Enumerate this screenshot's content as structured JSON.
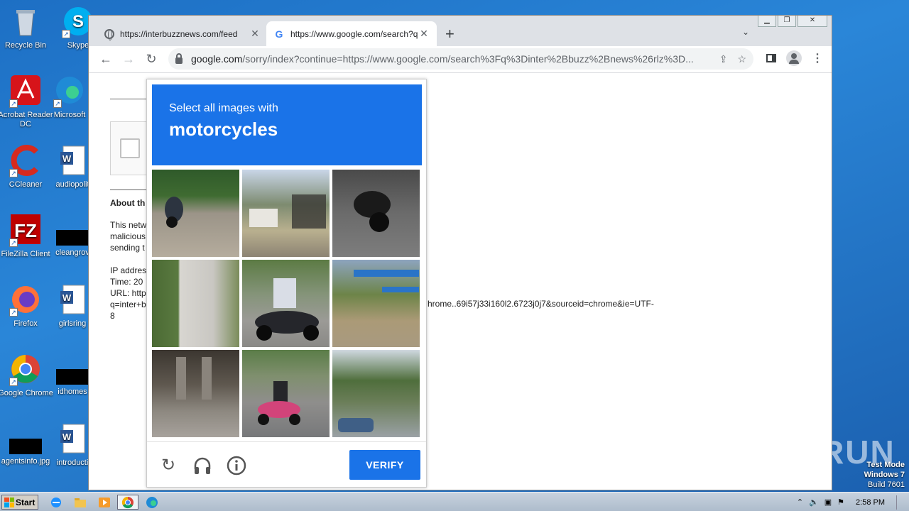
{
  "desktop": {
    "icons": [
      {
        "label": "Recycle Bin"
      },
      {
        "label": "Skype"
      },
      {
        "label": "Acrobat Reader DC"
      },
      {
        "label": "Microsoft"
      },
      {
        "label": "CCleaner"
      },
      {
        "label": "audiopolit"
      },
      {
        "label": "FileZilla Client"
      },
      {
        "label": "cleangrov"
      },
      {
        "label": "Firefox"
      },
      {
        "label": "girlsring"
      },
      {
        "label": "Google Chrome"
      },
      {
        "label": "idhomes"
      },
      {
        "label": "agentsinfo.jpg"
      },
      {
        "label": "introducti"
      }
    ],
    "watermark": "ANY RUN",
    "test_mode": {
      "line1": "Test Mode",
      "line2": "Windows 7",
      "line3": "Build 7601"
    }
  },
  "browser": {
    "tabs": [
      {
        "title": "https://interbuzznews.com/feed",
        "active": false,
        "icon": "globe-icon"
      },
      {
        "title": "https://www.google.com/search?q=",
        "active": true,
        "icon": "google-icon"
      }
    ],
    "address": {
      "domain": "google.com",
      "rest": "/sorry/index?continue=https://www.google.com/search%3Fq%3Dinter%2Bbuzz%2Bnews%26rlz%3D..."
    }
  },
  "page": {
    "about_heading": "About th",
    "para_lines": [
      "This netw",
      "malicious",
      "sending t"
    ],
    "info_lines": [
      "IP addres",
      "Time: 20",
      "URL: http",
      "q=inter+b",
      "8"
    ],
    "url_tail": "hrome..69i57j33i160l2.6723j0j7&sourceid=chrome&ie=UTF-"
  },
  "captcha": {
    "instruction": "Select all images with",
    "target": "motorcycles",
    "verify_label": "VERIFY",
    "tiles": [
      {
        "name": "road-with-riders"
      },
      {
        "name": "yard-with-cart"
      },
      {
        "name": "parked-motorcycle"
      },
      {
        "name": "white-gate"
      },
      {
        "name": "scooter-rider"
      },
      {
        "name": "market-stall"
      },
      {
        "name": "bridge-underpass"
      },
      {
        "name": "pink-scooter-rider"
      },
      {
        "name": "street-trees-car"
      }
    ]
  },
  "taskbar": {
    "start_label": "Start",
    "clock": "2:58 PM"
  }
}
